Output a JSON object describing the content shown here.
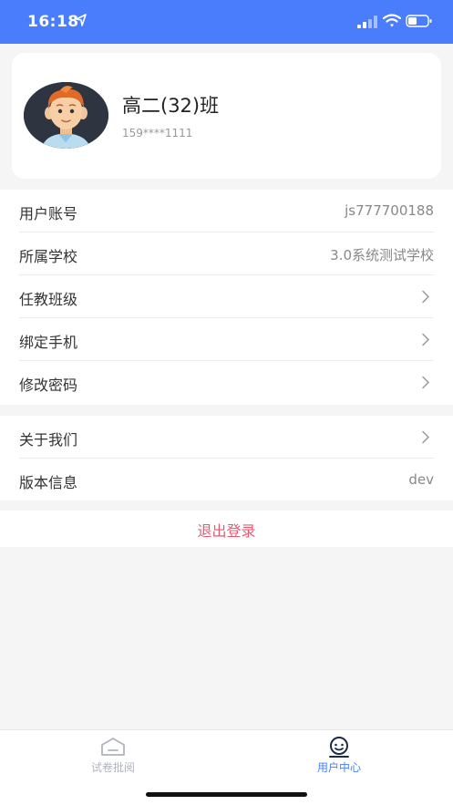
{
  "status_bar": {
    "time": "16:18",
    "bg_color": "#4a7dfc",
    "icons": [
      "location-arrow-icon",
      "signal-icon",
      "wifi-icon",
      "battery-icon"
    ]
  },
  "profile": {
    "name": "高二(32)班",
    "phone": "159****1111",
    "avatar_icon": "boy-avatar-icon"
  },
  "settings_group_1": [
    {
      "label": "用户账号",
      "value": "js777700188",
      "chevron": false
    },
    {
      "label": "所属学校",
      "value": "3.0系统测试学校",
      "chevron": false
    },
    {
      "label": "任教班级",
      "value": "",
      "chevron": true
    },
    {
      "label": "绑定手机",
      "value": "",
      "chevron": true
    },
    {
      "label": "修改密码",
      "value": "",
      "chevron": true
    }
  ],
  "settings_group_2": [
    {
      "label": "关于我们",
      "value": "",
      "chevron": true
    },
    {
      "label": "版本信息",
      "value": "dev",
      "chevron": false
    }
  ],
  "logout_label": "退出登录",
  "logout_color": "#e35a72",
  "tabbar": {
    "tabs": [
      {
        "label": "试卷批阅",
        "icon": "home-icon",
        "active": false
      },
      {
        "label": "用户中心",
        "icon": "user-icon",
        "active": true
      }
    ],
    "active_color": "#4a7dfc",
    "inactive_color": "#b0b4bc"
  }
}
